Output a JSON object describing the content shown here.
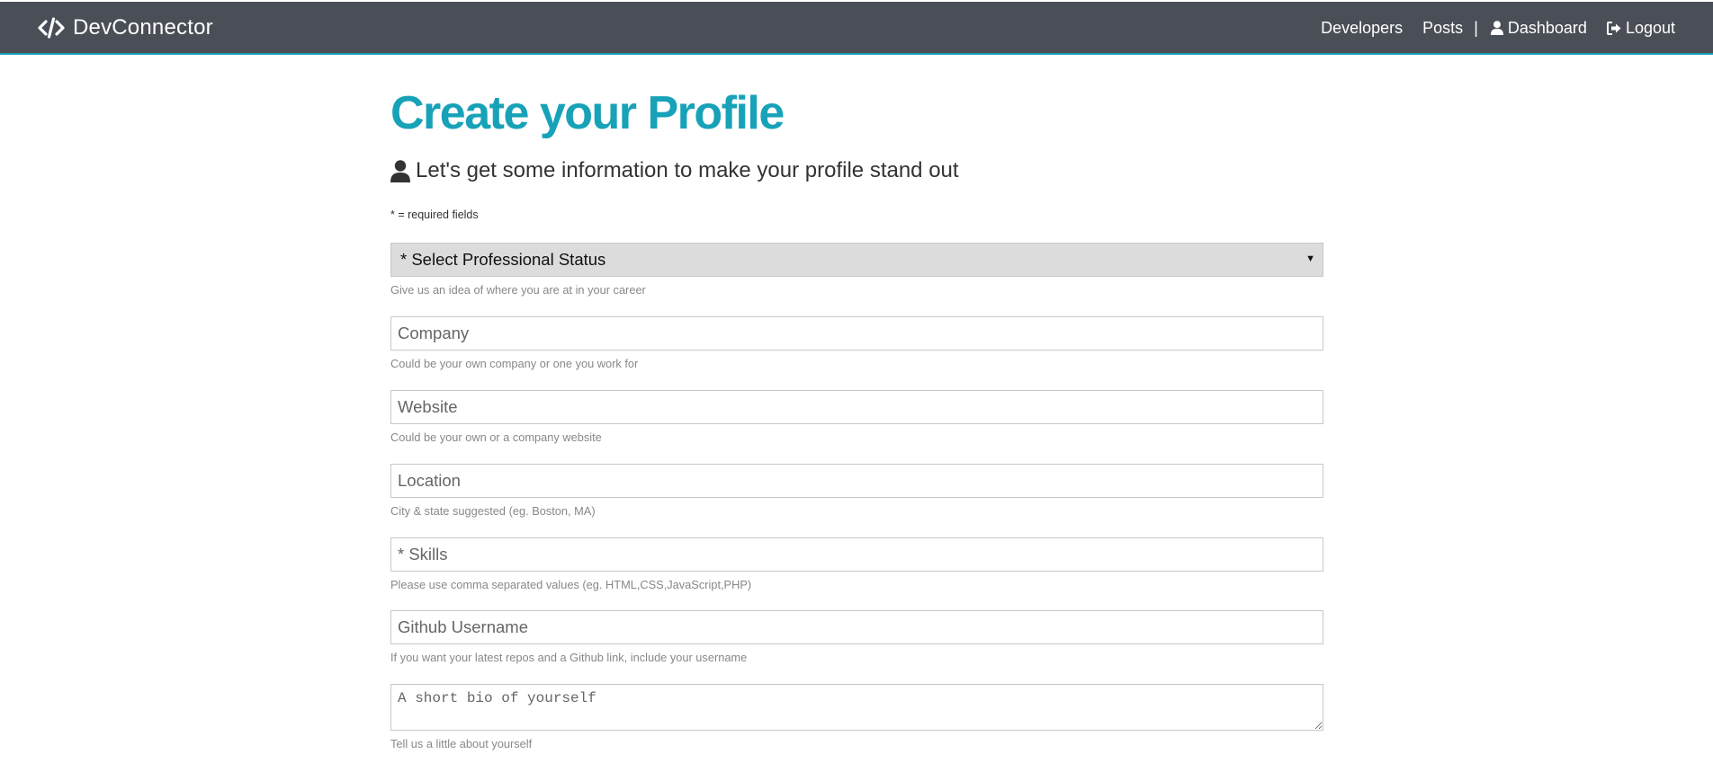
{
  "navbar": {
    "brand": "DevConnector",
    "links": {
      "developers": "Developers",
      "posts": "Posts",
      "separator": "|",
      "dashboard": "Dashboard",
      "logout": "Logout"
    },
    "icons": {
      "brand": "code-icon",
      "dashboard": "user-icon",
      "logout": "sign-out-icon"
    }
  },
  "colors": {
    "navbar_bg": "#4a4e56",
    "accent": "#17a2b8",
    "helper_text": "#888888"
  },
  "main": {
    "title": "Create your Profile",
    "lead": "Let's get some information to make your profile stand out",
    "lead_icon": "user-icon",
    "required_note": "* = required fields"
  },
  "form": {
    "status": {
      "selected": "* Select Professional Status",
      "help": "Give us an idea of where you are at in your career"
    },
    "company": {
      "placeholder": "Company",
      "value": "",
      "help": "Could be your own company or one you work for"
    },
    "website": {
      "placeholder": "Website",
      "value": "",
      "help": "Could be your own or a company website"
    },
    "location": {
      "placeholder": "Location",
      "value": "",
      "help": "City & state suggested (eg. Boston, MA)"
    },
    "skills": {
      "placeholder": "* Skills",
      "value": "",
      "help": "Please use comma separated values (eg. HTML,CSS,JavaScript,PHP)"
    },
    "github": {
      "placeholder": "Github Username",
      "value": "",
      "help": "If you want your latest repos and a Github link, include your username"
    },
    "bio": {
      "placeholder": "A short bio of yourself",
      "value": "",
      "help": "Tell us a little about yourself"
    }
  }
}
